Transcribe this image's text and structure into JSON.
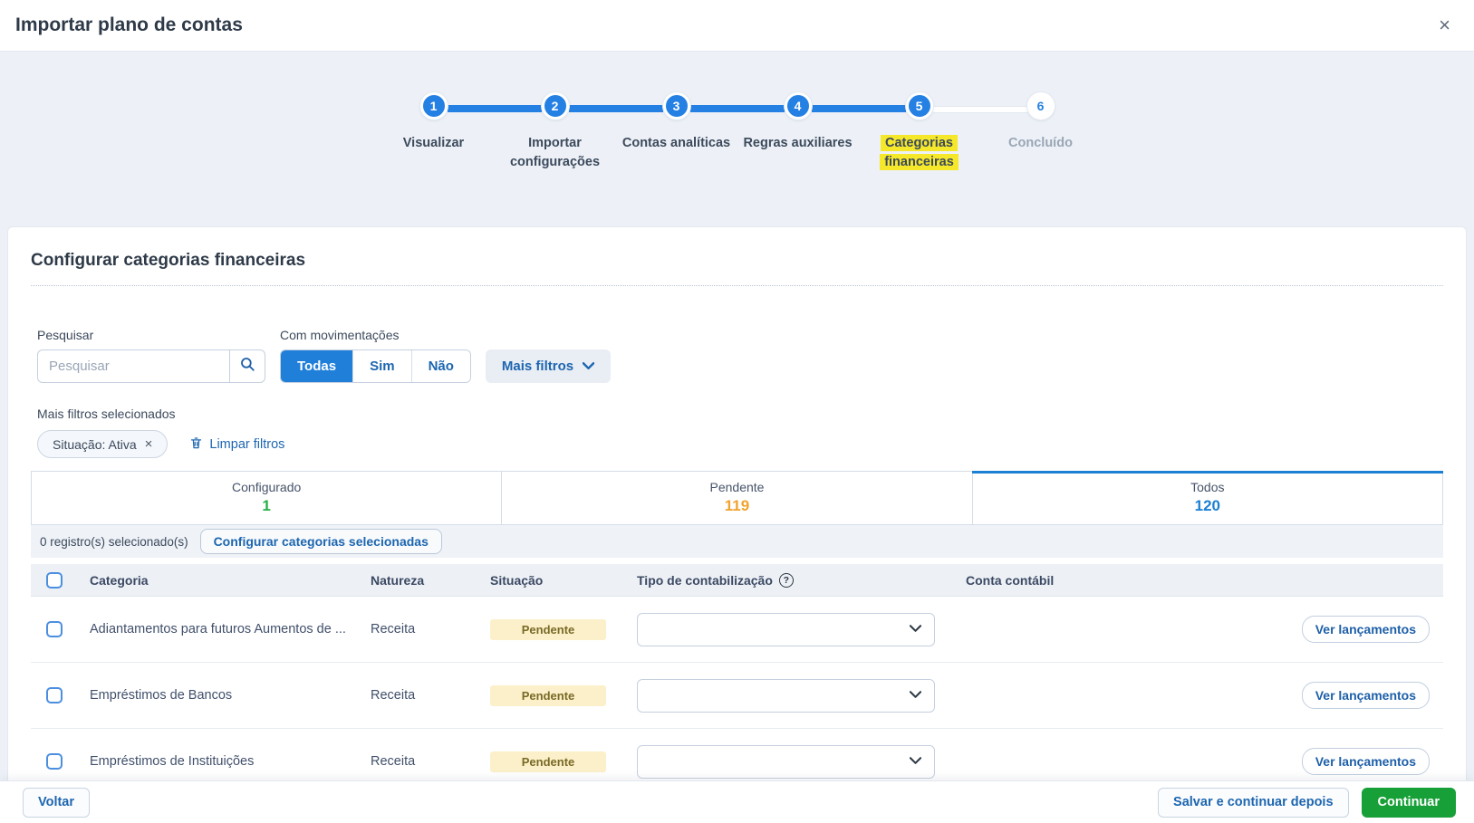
{
  "header": {
    "title": "Importar plano de contas",
    "close_glyph": "×"
  },
  "stepper": {
    "steps": [
      {
        "number": "1",
        "label": "Visualizar",
        "state": "done"
      },
      {
        "number": "2",
        "label": "Importar configurações",
        "state": "done"
      },
      {
        "number": "3",
        "label": "Contas analíticas",
        "state": "done"
      },
      {
        "number": "4",
        "label": "Regras auxiliares",
        "state": "done"
      },
      {
        "number": "5",
        "label": "Categorias financeiras",
        "state": "current-highlighted"
      },
      {
        "number": "6",
        "label": "Concluído",
        "state": "pending"
      }
    ]
  },
  "section": {
    "title": "Configurar categorias financeiras"
  },
  "filters": {
    "search_label": "Pesquisar",
    "search_placeholder": "Pesquisar",
    "search_value": "",
    "movements_label": "Com movimentações",
    "options": {
      "all": "Todas",
      "yes": "Sim",
      "no": "Não"
    },
    "selected_option": "Todas",
    "more_filters": "Mais filtros",
    "selected_filters_label": "Mais filtros selecionados",
    "chip": {
      "label": "Situação: Ativa",
      "close_glyph": "×"
    },
    "clear_filters": "Limpar filtros"
  },
  "tabs": [
    {
      "label": "Configurado",
      "count": "1",
      "color": "#27ae47",
      "active": false
    },
    {
      "label": "Pendente",
      "count": "119",
      "color": "#f0a32f",
      "active": false
    },
    {
      "label": "Todos",
      "count": "120",
      "color": "#1b7fd4",
      "active": true
    }
  ],
  "selection": {
    "summary": "0 registro(s) selecionado(s)",
    "configure_button": "Configurar categorias selecionadas"
  },
  "table": {
    "headers": {
      "category": "Categoria",
      "nature": "Natureza",
      "status": "Situação",
      "type": "Tipo de contabilização",
      "help_glyph": "?",
      "account": "Conta contábil"
    },
    "rows": [
      {
        "category": "Adiantamentos para futuros Aumentos de ...",
        "nature": "Receita",
        "status": "Pendente",
        "type_value": "",
        "account": "",
        "action": "Ver lançamentos"
      },
      {
        "category": "Empréstimos de Bancos",
        "nature": "Receita",
        "status": "Pendente",
        "type_value": "",
        "account": "",
        "action": "Ver lançamentos"
      },
      {
        "category": "Empréstimos de Instituições",
        "nature": "Receita",
        "status": "Pendente",
        "type_value": "",
        "account": "",
        "action": "Ver lançamentos"
      }
    ]
  },
  "footer": {
    "back": "Voltar",
    "save": "Salvar e continuar depois",
    "continue": "Continuar"
  },
  "colors": {
    "primary_blue": "#2580e4",
    "link_blue": "#1d66b0",
    "active_tab_blue": "#1b7fd4",
    "configured_green": "#27ae47",
    "pending_orange": "#f0a32f",
    "continue_green": "#18a038",
    "step_highlight_yellow": "#f5e72a",
    "badge_bg": "#fbf0c9",
    "badge_text": "#7a6a26"
  }
}
